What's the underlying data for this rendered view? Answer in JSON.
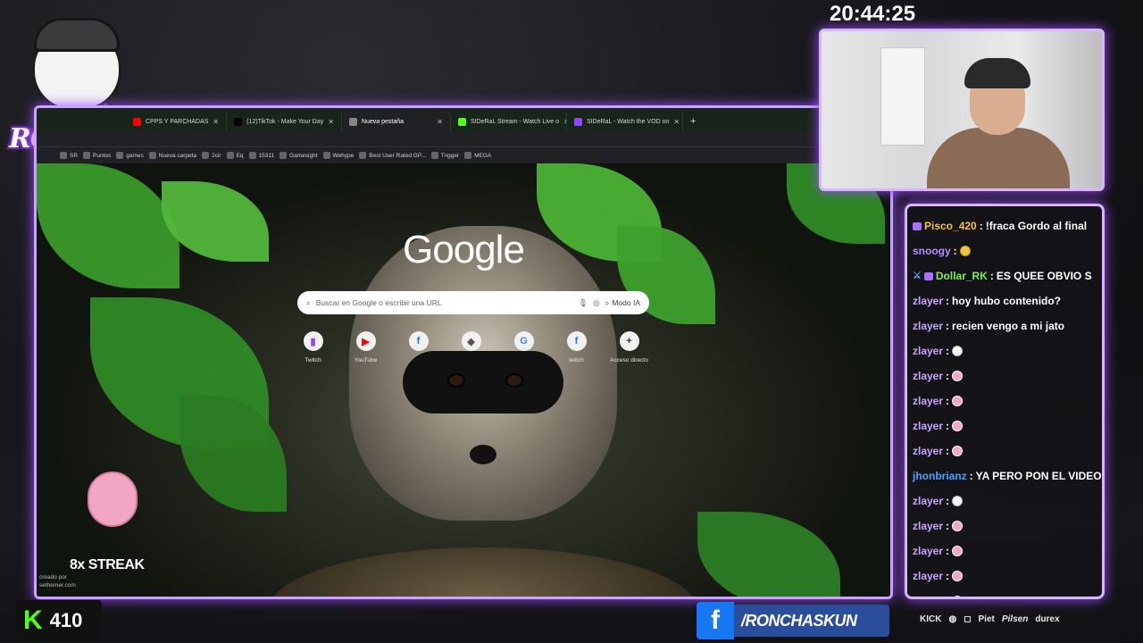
{
  "overlay": {
    "logo_text": "RONCHAS",
    "clock": "20:44:25",
    "streak": "8x STREAK",
    "credit": [
      "creado por",
      "sethemer.com"
    ],
    "kick_count": "410",
    "facebook_handle": "/RONCHASKUN",
    "sponsors": [
      "KICK",
      "Piet",
      "Pilsen",
      "durex"
    ]
  },
  "browser": {
    "tabs": [
      {
        "label": "CPPS Y PARCHADAS",
        "favicon_color": "#ff0000"
      },
      {
        "label": "(12)TikTok - Make Your Day",
        "favicon_color": "#000000"
      },
      {
        "label": "Nueva pestaña",
        "favicon_color": "#888888",
        "active": true
      },
      {
        "label": "SIDeRaL Stream - Watch Live o",
        "favicon_color": "#53fc18"
      },
      {
        "label": "SIDeRaL - Watch the VOD on",
        "favicon_color": "#9146ff"
      }
    ],
    "new_tab": "+",
    "zoom_icon": "search-icon",
    "bookmarks": [
      "SR",
      "Puntos",
      "games",
      "Nueva carpeta",
      "2cir",
      "Eq",
      "15311",
      "Gamesight",
      "Wehype",
      "Best User Rated GP...",
      "Trigger",
      "MEGA"
    ],
    "new_tab_page": {
      "logo": "Google",
      "search_placeholder": "Buscar en Google o escribir una URL",
      "ai_mode": "Modo IA",
      "shortcuts": [
        {
          "label": "Twitch",
          "icon": "twitch-icon",
          "color": "#9146ff"
        },
        {
          "label": "YouTube",
          "icon": "youtube-icon",
          "color": "#ff0000"
        },
        {
          "label": "",
          "icon": "facebook-icon",
          "color": "#1877f2"
        },
        {
          "label": "",
          "icon": "site-icon",
          "color": "#555555"
        },
        {
          "label": "",
          "icon": "translate-icon",
          "color": "#4285f4"
        },
        {
          "label": "twitch",
          "icon": "facebook-icon",
          "color": "#1877f2"
        },
        {
          "label": "Acceso directo",
          "icon": "plus-icon",
          "color": "#333333"
        }
      ]
    }
  },
  "chat": {
    "messages": [
      {
        "user": "Pisco_420",
        "color": "#f5c242",
        "text": "!fraca Gordo al final",
        "badge": true
      },
      {
        "user": "snoogy",
        "color": "#b48cff",
        "text": "",
        "emote": "yellow"
      },
      {
        "user": "Dollar_RK",
        "color": "#7cf04e",
        "text": "ES QUEE OBVIO S",
        "badge": true,
        "sword": true
      },
      {
        "user": "zlayer",
        "color": "#c9a4ff",
        "text": "hoy hubo contenido?"
      },
      {
        "user": "zlayer",
        "color": "#c9a4ff",
        "text": "recien vengo a mi jato"
      },
      {
        "user": "zlayer",
        "color": "#c9a4ff",
        "text": "",
        "emote": "ghost"
      },
      {
        "user": "zlayer",
        "color": "#c9a4ff",
        "text": "",
        "emote": "pink"
      },
      {
        "user": "zlayer",
        "color": "#c9a4ff",
        "text": "",
        "emote": "pink"
      },
      {
        "user": "zlayer",
        "color": "#c9a4ff",
        "text": "",
        "emote": "pink"
      },
      {
        "user": "zlayer",
        "color": "#c9a4ff",
        "text": "",
        "emote": "pink"
      },
      {
        "user": "jhonbrianz",
        "color": "#4ea1ff",
        "text": "YA PERO PON EL VIDEO"
      },
      {
        "user": "zlayer",
        "color": "#c9a4ff",
        "text": "",
        "emote": "ghost"
      },
      {
        "user": "zlayer",
        "color": "#c9a4ff",
        "text": "",
        "emote": "pink"
      },
      {
        "user": "zlayer",
        "color": "#c9a4ff",
        "text": "",
        "emote": "pink"
      },
      {
        "user": "zlayer",
        "color": "#c9a4ff",
        "text": "",
        "emote": "pink"
      },
      {
        "user": "zlayer",
        "color": "#c9a4ff",
        "text": "",
        "emote": "pink"
      }
    ]
  }
}
